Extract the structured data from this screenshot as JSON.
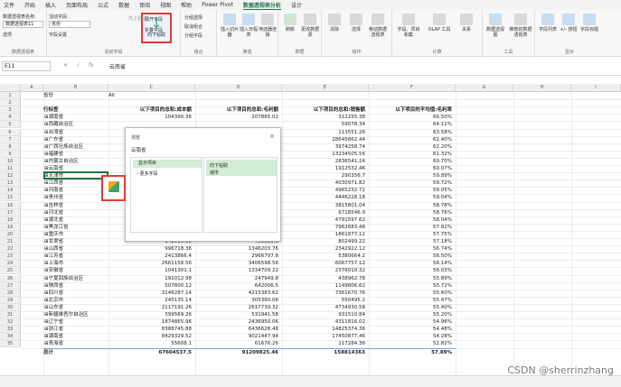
{
  "menu": [
    "文件",
    "开始",
    "插入",
    "页面布局",
    "公式",
    "数据",
    "审阅",
    "视图",
    "帮助",
    "Power Pivot",
    "数据透视表分析",
    "设计"
  ],
  "active_menu_index": 10,
  "ribbon": {
    "pivot_name_label": "数据透视表名称:",
    "pivot_name_value": "数据透视表11",
    "options_label": "选项",
    "group_pivot": "数据透视表",
    "active_field_label": "活动字段:",
    "active_field_value": "省份",
    "field_settings": "字段设置",
    "drill_down": "向下钻取",
    "drill_up": "向上钻取",
    "expand_field": "展开字段",
    "collapse_field": "折叠字段",
    "group_active": "活动字段",
    "group_selection": "分组选择",
    "ungroup": "取消组合",
    "group_field": "分组字段",
    "group_combine": "组合",
    "insert_slicer": "插入切片器",
    "insert_timeline": "插入日程表",
    "filter_connections": "筛选器连接",
    "group_filter": "筛选",
    "refresh": "刷新",
    "change_source": "更改数据源",
    "group_data": "数据",
    "clear": "清除",
    "select": "选择",
    "move_pivot": "移动数据透视表",
    "group_actions": "操作",
    "fields_items": "字段、项目和集",
    "olap_tools": "OLAP 工具",
    "relationships": "关系",
    "group_calc": "计算",
    "pivot_chart": "数据透视图",
    "recommended": "推荐的数据透视表",
    "group_tools": "工具",
    "field_list": "字段列表",
    "buttons": "+/- 按钮",
    "headers": "字段标题",
    "group_show": "显示"
  },
  "formula_bar": {
    "name_box": "E11",
    "content": "云南省"
  },
  "columns": [
    "A",
    "B",
    "C",
    "D",
    "E",
    "F",
    "G",
    "H",
    "I"
  ],
  "filter_row": {
    "label": "省份",
    "value": "All"
  },
  "headers": [
    "行标签",
    "以下项目的总和:成本额",
    "以下项目的总和:毛利额",
    "以下项目的总和:销售额",
    "以下项目的平均值:毛利率"
  ],
  "rows": [
    [
      "湖南省",
      "104390.36",
      "207865.02",
      "312255.38",
      "66.50%"
    ],
    [
      "西藏自治区",
      "",
      "",
      "59078.34",
      "64.11%"
    ],
    [
      "台湾省",
      "",
      "",
      "113551.26",
      "63.58%"
    ],
    [
      "广东省",
      "",
      "",
      "28645862.44",
      "62.40%"
    ],
    [
      "广西壮族自治区",
      "",
      "",
      "3974258.74",
      "62.20%"
    ],
    [
      "福建省",
      "",
      "",
      "13234505.56",
      "61.32%"
    ],
    [
      "内蒙古自治区",
      "",
      "",
      "2836541.24",
      "60.70%"
    ],
    [
      "云南省",
      "",
      "",
      "1912532.46",
      "60.07%"
    ],
    [
      "天津市",
      "",
      "",
      "290356.7",
      "59.89%"
    ],
    [
      "江西省",
      "",
      "",
      "4030971.82",
      "59.72%"
    ],
    [
      "河南省",
      "",
      "",
      "4965232.72",
      "59.05%"
    ],
    [
      "贵州省",
      "",
      "",
      "4446228.18",
      "59.04%"
    ],
    [
      "吉林省",
      "",
      "",
      "3815801.04",
      "58.78%"
    ],
    [
      "河北省",
      "",
      "",
      "6718546.9",
      "58.76%"
    ],
    [
      "湖北省",
      "",
      "",
      "4791597.62",
      "58.04%"
    ],
    [
      "黑龙江省",
      "",
      "",
      "7962683.48",
      "57.92%"
    ],
    [
      "重庆市",
      "786720.5",
      "1075156.62",
      "1861877.12",
      "57.75%"
    ],
    [
      "甘肃省",
      "342916.12",
      "459583.1",
      "802499.22",
      "57.18%"
    ],
    [
      "山西省",
      "996718.36",
      "1346203.76",
      "2342922.12",
      "56.74%"
    ],
    [
      "江苏省",
      "2413866.4",
      "2966797.8",
      "5380664.2",
      "56.50%"
    ],
    [
      "上海市",
      "2661158.56",
      "3406598.56",
      "6067757.12",
      "56.14%"
    ],
    [
      "安徽省",
      "1041301.1",
      "1334709.22",
      "2376010.32",
      "56.03%"
    ],
    [
      "宁夏回族自治区",
      "191012.98",
      "247949.8",
      "438962.78",
      "55.89%"
    ],
    [
      "陕西省",
      "507800.12",
      "642006.5",
      "1149806.62",
      "55.72%"
    ],
    [
      "四川省",
      "3146287.14",
      "4215383.62",
      "7361670.76",
      "55.60%"
    ],
    [
      "北京市",
      "245135.14",
      "305360.06",
      "550495.2",
      "55.47%"
    ],
    [
      "山东省",
      "2117191.26",
      "2617739.32",
      "4734930.58",
      "55.40%"
    ],
    [
      "新疆维吾尔自治区",
      "399569.26",
      "531941.58",
      "931510.84",
      "55.20%"
    ],
    [
      "辽宁省",
      "1874865.96",
      "2436950.06",
      "4311816.02",
      "54.96%"
    ],
    [
      "浙江省",
      "8388745.88",
      "6436628.48",
      "14825374.36",
      "54.48%"
    ],
    [
      "湖南省",
      "8429329.52",
      "9021447.94",
      "17450877.46",
      "54.28%"
    ],
    [
      "青海省",
      "55608.1",
      "61676.26",
      "117284.36",
      "52.82%"
    ]
  ],
  "total": [
    "总计",
    "67604537.5",
    "91209825.46",
    "158814363",
    "57.89%"
  ],
  "popup": {
    "title": "浏览",
    "close": "×",
    "subtitle": "云南省",
    "left_item": "显示项目",
    "left_more": "更多字段",
    "right_header": "向下钻取",
    "right_item": "城市"
  },
  "watermark": "CSDN @sherrinzhang"
}
